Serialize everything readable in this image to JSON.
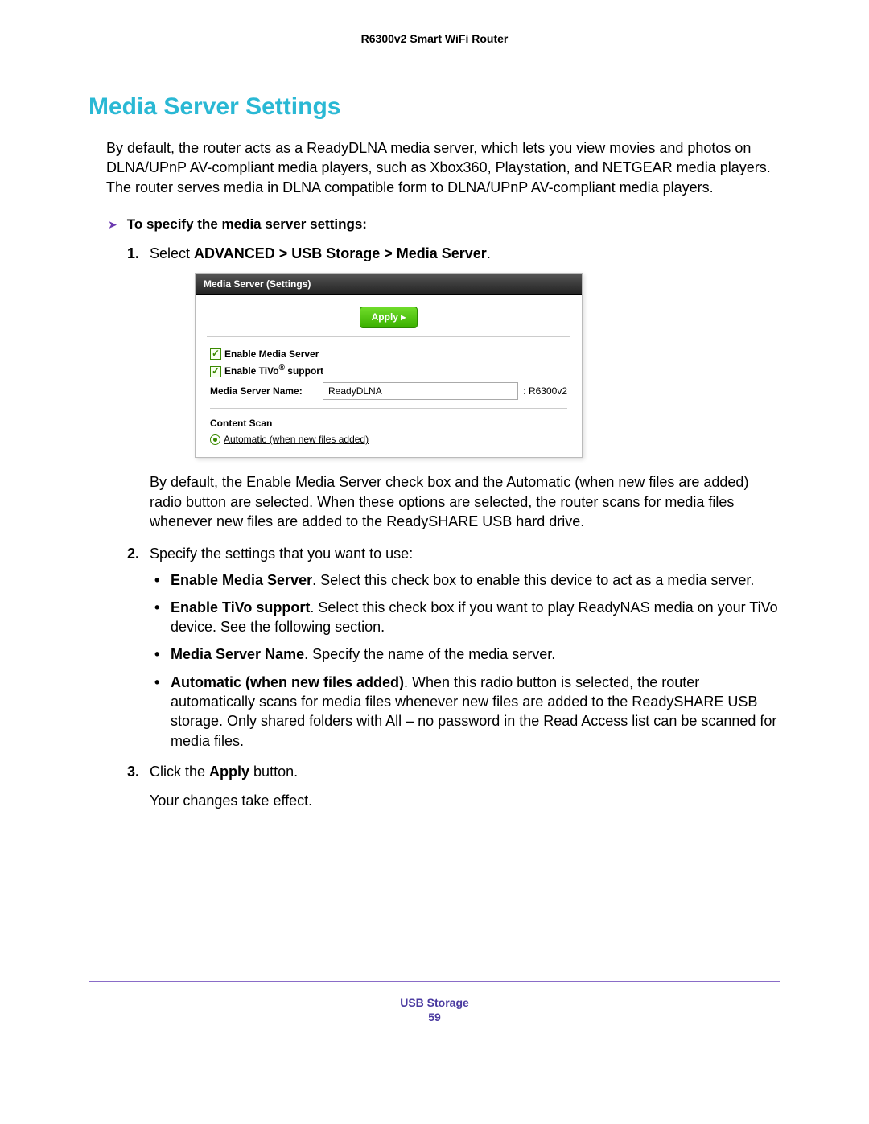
{
  "header": {
    "product": "R6300v2 Smart WiFi Router"
  },
  "title": "Media Server Settings",
  "intro": "By default, the router acts as a ReadyDLNA media server, which lets you view movies and photos on DLNA/UPnP AV-compliant media players, such as Xbox360, Playstation, and NETGEAR media players. The router serves media in DLNA compatible form to DLNA/UPnP AV-compliant media players.",
  "procedure": {
    "heading": "To specify the media server settings:",
    "steps": {
      "s1": {
        "num": "1.",
        "text_a": "Select ",
        "bold_a": "ADVANCED > USB Storage > Media Server",
        "text_b": "."
      },
      "s2": {
        "num": "2.",
        "text": "Specify the settings that you want to use:"
      },
      "s3": {
        "num": "3.",
        "text_a": "Click the ",
        "bold_a": "Apply",
        "text_b": " button."
      }
    }
  },
  "uishot": {
    "title": "Media Server (Settings)",
    "apply": "Apply ▸",
    "ck_media": "Enable Media Server",
    "ck_tivo_pre": "Enable TiVo",
    "ck_tivo_sup": "®",
    "ck_tivo_post": " support",
    "name_label": "Media Server Name:",
    "name_value": "ReadyDLNA",
    "name_suffix": ": R6300v2",
    "scan_title": "Content Scan",
    "scan_opt": "Automatic (when new files added)"
  },
  "afterShot": "By default, the Enable Media Server check box and the Automatic (when new files are added) radio button are selected. When these options are selected, the router scans for media files whenever new files are added to the ReadySHARE USB hard drive.",
  "bullets": {
    "b1": {
      "bold": "Enable Media Server",
      "text": ". Select this check box to enable this device to act as a media server."
    },
    "b2": {
      "bold": "Enable TiVo support",
      "text": ". Select this check box if you want to play ReadyNAS media on your TiVo device. See the following section."
    },
    "b3": {
      "bold": "Media Server Name",
      "text": ". Specify the name of the media server."
    },
    "b4": {
      "bold": "Automatic (when new files added)",
      "text": ". When this radio button is selected, the router automatically scans for media files whenever new files are added to the ReadySHARE USB storage. Only shared folders with All – no password in the Read Access list can be scanned for media files."
    }
  },
  "effect": "Your changes take effect.",
  "footer": {
    "section": "USB Storage",
    "page": "59"
  }
}
